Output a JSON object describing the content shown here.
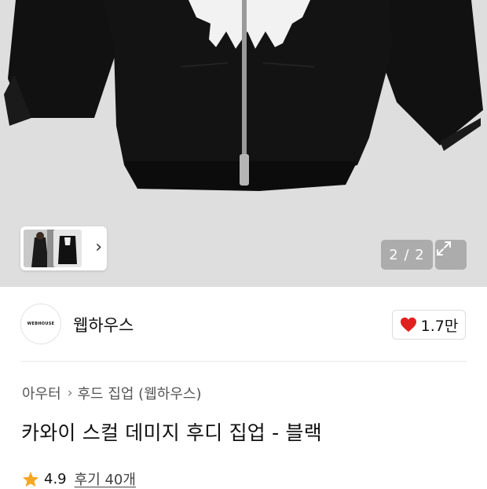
{
  "gallery": {
    "page_indicator": "2 / 2",
    "thumbnail_count": 2
  },
  "seller": {
    "logo_text": "WEBHOUSE",
    "name": "웹하우스"
  },
  "like": {
    "count": "1.7만",
    "icon": "heart-icon",
    "color": "#e0201f"
  },
  "breadcrumb": {
    "category": "아우터",
    "subcategory": "후드 집업 (웹하우스)"
  },
  "product": {
    "title": "카와이 스컬 데미지 후디 집업 - 블랙"
  },
  "rating": {
    "score": "4.9",
    "reviews": "후기 40개",
    "star_color": "#f5a623"
  }
}
